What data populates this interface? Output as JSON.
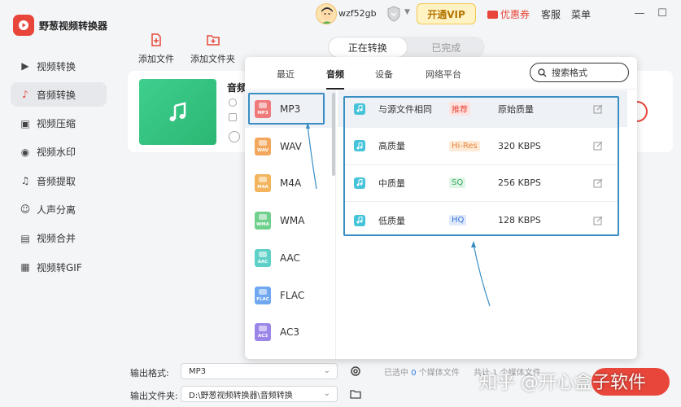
{
  "app": {
    "name": "野葱视频转换器",
    "logo_icon": "play-logo-icon",
    "brand_color": "#e8463a"
  },
  "topbar": {
    "username": "wzf52gb",
    "vip_label": "开通VIP",
    "coupon_label": "优惠券",
    "service_label": "客服",
    "menu_label": "菜单"
  },
  "sidebar": {
    "items": [
      {
        "label": "视频转换",
        "icon": "video-convert-icon",
        "active": false
      },
      {
        "label": "音频转换",
        "icon": "audio-convert-icon",
        "active": true
      },
      {
        "label": "视频压缩",
        "icon": "video-compress-icon",
        "active": false
      },
      {
        "label": "视频水印",
        "icon": "video-watermark-icon",
        "active": false
      },
      {
        "label": "音频提取",
        "icon": "audio-extract-icon",
        "active": false
      },
      {
        "label": "人声分离",
        "icon": "voice-separate-icon",
        "active": false
      },
      {
        "label": "视频合并",
        "icon": "video-merge-icon",
        "active": false
      },
      {
        "label": "视频转GIF",
        "icon": "video-to-gif-icon",
        "active": false
      }
    ]
  },
  "toolbar": {
    "add_file_label": "添加文件",
    "add_folder_label": "添加文件夹"
  },
  "status_tabs": {
    "converting_label": "正在转换",
    "done_label": "已完成"
  },
  "file_card": {
    "name": "音频"
  },
  "popup": {
    "tabs": [
      {
        "label": "最近",
        "active": false
      },
      {
        "label": "音频",
        "active": true
      },
      {
        "label": "设备",
        "active": false
      },
      {
        "label": "网络平台",
        "active": false
      }
    ],
    "search_placeholder": "搜索格式",
    "formats": [
      {
        "label": "MP3",
        "tag": "MP3",
        "color": "#f07a7a",
        "selected": true
      },
      {
        "label": "WAV",
        "tag": "WAV",
        "color": "#f2a75c"
      },
      {
        "label": "M4A",
        "tag": "M4A",
        "color": "#f2b45c"
      },
      {
        "label": "WMA",
        "tag": "WMA",
        "color": "#6fd08c"
      },
      {
        "label": "AAC",
        "tag": "AAC",
        "color": "#5fd0c7"
      },
      {
        "label": "FLAC",
        "tag": "FLAC",
        "color": "#6fa8f0"
      },
      {
        "label": "AC3",
        "tag": "AC3",
        "color": "#9b86e8"
      }
    ],
    "qualities": [
      {
        "name": "与源文件相同",
        "badge": "推荐",
        "badge_bg": "#fde3e0",
        "badge_color": "#e8463a",
        "rate": "原始质量"
      },
      {
        "name": "高质量",
        "badge": "Hi-Res",
        "badge_bg": "#fdebd8",
        "badge_color": "#e8843a",
        "rate": "320 KBPS"
      },
      {
        "name": "中质量",
        "badge": "SQ",
        "badge_bg": "#dff5e6",
        "badge_color": "#3aa860",
        "rate": "256 KBPS"
      },
      {
        "name": "低质量",
        "badge": "HQ",
        "badge_bg": "#dfe9fb",
        "badge_color": "#3a78d8",
        "rate": "128 KBPS"
      }
    ]
  },
  "bottom": {
    "output_format_label": "输出格式:",
    "output_format_value": "MP3",
    "output_folder_label": "输出文件夹:",
    "output_folder_value": "D:\\野葱视频转换器\\音频转换",
    "selected_prefix": "已选中",
    "selected_count": "0",
    "selected_suffix": "个媒体文件",
    "total_text": "共计 1 个媒体文件"
  },
  "watermark": "知乎 @开心盒子软件"
}
